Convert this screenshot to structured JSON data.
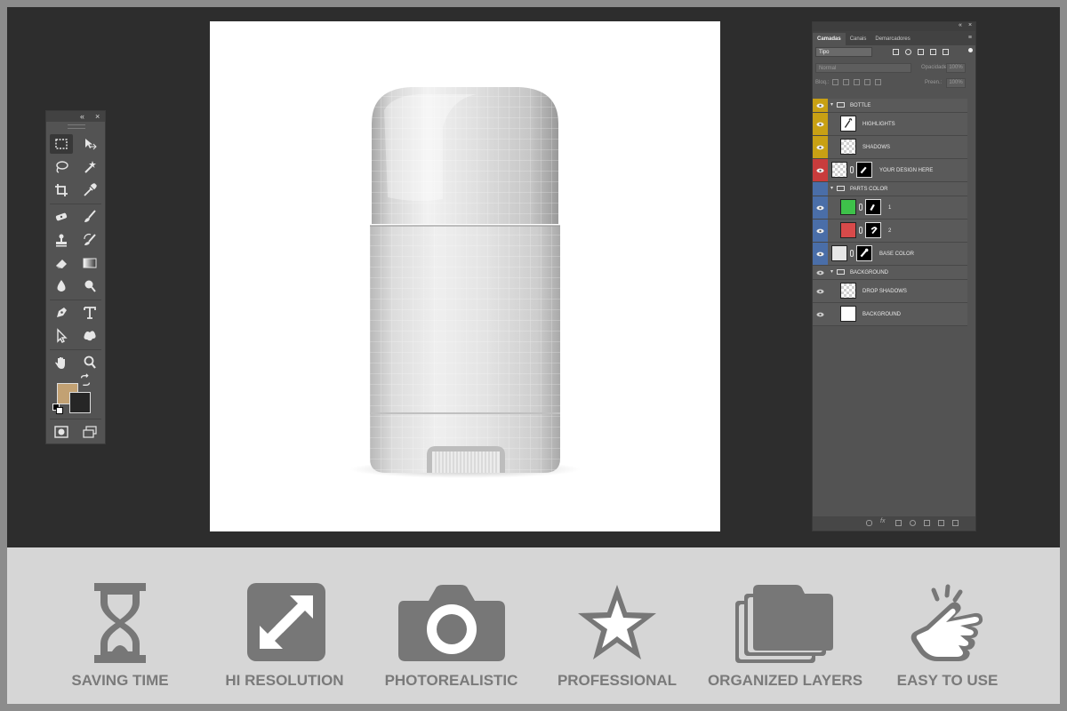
{
  "app": {
    "name": "photoshop-mockup-preview"
  },
  "tools_panel": {
    "collapse_glyph": "«",
    "close_glyph": "×",
    "tools": [
      "rectangular-marquee-icon",
      "move-icon",
      "lasso-icon",
      "magic-wand-icon",
      "crop-icon",
      "eyedropper-icon",
      "healing-brush-icon",
      "brush-icon",
      "clone-stamp-icon",
      "history-brush-icon",
      "eraser-icon",
      "gradient-icon",
      "blur-icon",
      "dodge-icon",
      "pen-icon",
      "type-icon",
      "path-selection-icon",
      "custom-shape-icon",
      "hand-icon",
      "zoom-icon",
      "quick-mask-icon",
      "screen-mode-icon"
    ],
    "foreground_color": "#c2a173",
    "background_color": "#262626"
  },
  "layers_panel": {
    "tabs": [
      "Camadas",
      "Canais",
      "Demarcadores"
    ],
    "active_tab": "Camadas",
    "filter_kind": "Tipo",
    "blend_mode": "Normal",
    "opacity_label": "Opacidade:",
    "opacity_value": "100%",
    "lock_label": "Bloq.:",
    "fill_label": "Preen.:",
    "fill_value": "100%",
    "layers": [
      {
        "name": "BOTTLE",
        "type": "group",
        "label_color": "#c8a014"
      },
      {
        "name": "HIGHLIGHTS",
        "type": "layer",
        "label_color": "#c8a014"
      },
      {
        "name": "SHADOWS",
        "type": "layer",
        "label_color": "#c8a014"
      },
      {
        "name": "YOUR DESIGN HERE",
        "type": "smart",
        "label_color": "#c83c3c"
      },
      {
        "name": "PARTS COLOR",
        "type": "group",
        "label_color": "#4a6ea8"
      },
      {
        "name": "1",
        "type": "fill",
        "label_color": "#4a6ea8",
        "swatch": "#3ec24a"
      },
      {
        "name": "2",
        "type": "fill",
        "label_color": "#4a6ea8",
        "swatch": "#d84a4a"
      },
      {
        "name": "BASE COLOR",
        "type": "fill",
        "label_color": "#4a6ea8",
        "swatch": "#e6e6e6"
      },
      {
        "name": "BACKGROUND",
        "type": "group",
        "label_color": "#5a5a5a"
      },
      {
        "name": "DROP SHADOWS",
        "type": "layer",
        "label_color": "#5a5a5a"
      },
      {
        "name": "BACKGROUND",
        "type": "solid",
        "label_color": "#5a5a5a"
      }
    ]
  },
  "features": [
    {
      "label": "SAVING TIME",
      "icon": "hourglass-icon"
    },
    {
      "label": "HI RESOLUTION",
      "icon": "expand-arrows-icon"
    },
    {
      "label": "PHOTOREALISTIC",
      "icon": "camera-icon"
    },
    {
      "label": "PROFESSIONAL",
      "icon": "star-icon"
    },
    {
      "label": "ORGANIZED LAYERS",
      "icon": "stacked-layers-icon"
    },
    {
      "label": "EASY TO USE",
      "icon": "tap-hand-icon"
    }
  ],
  "colors": {
    "workspace": "#2d2d2d",
    "panel": "#535353",
    "feature_strip": "#d6d6d6",
    "feature_icon": "#777777"
  }
}
